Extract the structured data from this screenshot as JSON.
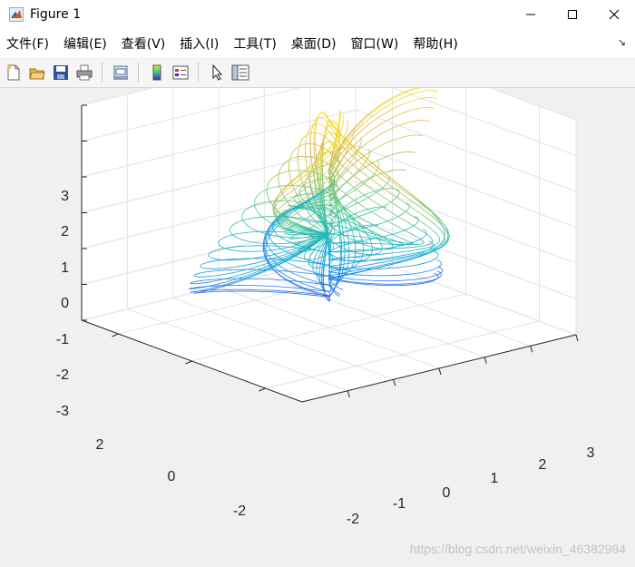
{
  "window": {
    "title": "Figure 1"
  },
  "menu": [
    "文件(F)",
    "编辑(E)",
    "查看(V)",
    "插入(I)",
    "工具(T)",
    "桌面(D)",
    "窗口(W)",
    "帮助(H)"
  ],
  "toolbar_icons": [
    "new-figure-icon",
    "open-file-icon",
    "save-icon",
    "print-icon",
    "link-plot-icon",
    "insert-colorbar-icon",
    "insert-legend-icon",
    "edit-plot-arrow-icon",
    "property-inspector-icon"
  ],
  "watermark": "https://blog.csdn.net/weixin_46382984",
  "chart_data": {
    "type": "surface-mesh",
    "title": "",
    "xlabel": "",
    "ylabel": "",
    "zlabel": "",
    "x_ticks": [
      "-2",
      "-1",
      "0",
      "1",
      "2",
      "3"
    ],
    "y_ticks": [
      "-2",
      "0",
      "2"
    ],
    "z_ticks": [
      "3",
      "2",
      "1",
      "0",
      "-1",
      "-2",
      "-3"
    ],
    "xlim": [
      -3,
      3
    ],
    "ylim": [
      -3,
      3
    ],
    "zlim": [
      -3,
      3
    ],
    "grid": true,
    "colormap": "parula",
    "colormap_stops": [
      "#3e26a8",
      "#2d73f1",
      "#14a8d6",
      "#35c3a3",
      "#8cc66d",
      "#e5b93f",
      "#f7e51f"
    ]
  }
}
